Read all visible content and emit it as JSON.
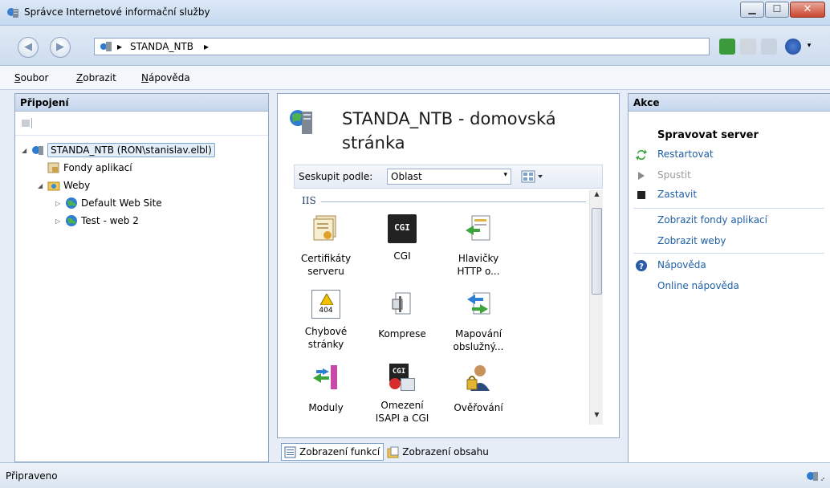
{
  "window": {
    "title": "Správce Internetové informační služby",
    "minimize": "▁",
    "maximize": "☐",
    "close": "✕"
  },
  "address": {
    "crumb": "STANDA_NTB",
    "sep1": "▸",
    "sep2": "▸"
  },
  "nav": {
    "back": "◀",
    "forward": "▶"
  },
  "menu": [
    {
      "underline": "S",
      "rest": "oubor"
    },
    {
      "underline": "Z",
      "rest": "obrazit"
    },
    {
      "underline": "N",
      "rest": "ápověda"
    }
  ],
  "connections": {
    "title": "Připojení",
    "tree": [
      {
        "label": "STANDA_NTB (RON\\stanislav.elbl)",
        "expander": "◢",
        "icon": "server-icon"
      },
      {
        "label": "Fondy aplikací",
        "expander": "",
        "icon": "app-pool-icon"
      },
      {
        "label": "Weby",
        "expander": "◢",
        "icon": "folder-icon"
      },
      {
        "label": "Default Web Site",
        "expander": "▷",
        "icon": "globe-icon"
      },
      {
        "label": "Test - web 2",
        "expander": "▷",
        "icon": "globe-icon"
      }
    ]
  },
  "center": {
    "title": "STANDA_NTB - domovská stránka",
    "group_label": "Seskupit podle:",
    "group_value": "Oblast",
    "dropdown_arrow": "▾",
    "section": "IIS",
    "features": [
      {
        "label": "Certifikáty serveru",
        "icon": "certificate-icon"
      },
      {
        "label": "CGI",
        "icon": "cgi-icon",
        "badge": "CGI"
      },
      {
        "label": "Hlavičky HTTP o...",
        "icon": "http-headers-icon"
      },
      {
        "label": "Chybové stránky",
        "icon": "error-pages-icon",
        "badge": "404"
      },
      {
        "label": "Komprese",
        "icon": "compression-icon"
      },
      {
        "label": "Mapování obslužný...",
        "icon": "handler-mappings-icon"
      },
      {
        "label": "Moduly",
        "icon": "modules-icon"
      },
      {
        "label": "Omezení ISAPI a CGI",
        "icon": "isapi-restrictions-icon",
        "badge": "CGI"
      },
      {
        "label": "Ověřování",
        "icon": "authentication-icon"
      }
    ],
    "scroll_up": "▲",
    "scroll_down": "▼",
    "tabs": [
      "Zobrazení funkcí",
      "Zobrazení obsahu"
    ]
  },
  "actions": {
    "title": "Akce",
    "manage": "Spravovat server",
    "items": [
      {
        "label": "Restartovat",
        "icon": "restart-icon",
        "disabled": false
      },
      {
        "label": "Spustit",
        "icon": "start-icon",
        "disabled": true
      },
      {
        "label": "Zastavit",
        "icon": "stop-icon",
        "disabled": false
      },
      {
        "label": "Zobrazit fondy aplikací",
        "icon": "",
        "disabled": false
      },
      {
        "label": "Zobrazit weby",
        "icon": "",
        "disabled": false
      },
      {
        "label": "Nápověda",
        "icon": "help-icon",
        "disabled": false
      },
      {
        "label": "Online nápověda",
        "icon": "",
        "disabled": false
      }
    ]
  },
  "status": {
    "text": "Připraveno"
  },
  "colors": {
    "link": "#1f5fa5",
    "accent": "#7da2ce"
  }
}
